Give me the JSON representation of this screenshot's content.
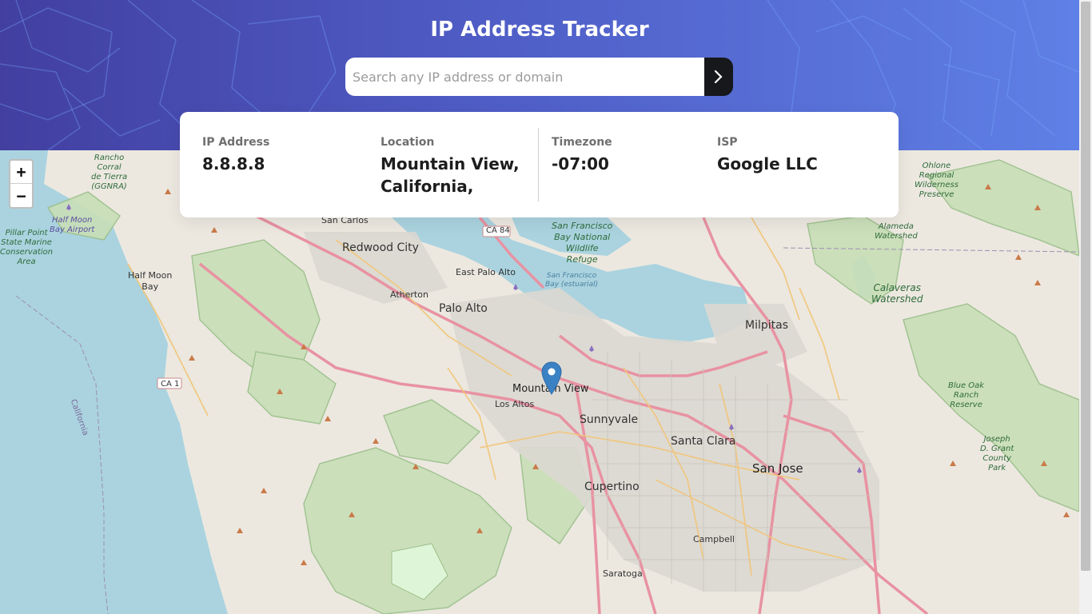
{
  "header": {
    "title": "IP Address Tracker"
  },
  "search": {
    "placeholder": "Search any IP address or domain",
    "value": "",
    "submit_icon": "chevron-right-icon"
  },
  "info": {
    "ip_label": "IP Address",
    "ip_value": "8.8.8.8",
    "location_label": "Location",
    "location_line1": "Mountain View,",
    "location_line2": "California,",
    "timezone_label": "Timezone",
    "timezone_value": "-07:00",
    "isp_label": "ISP",
    "isp_value": "Google LLC"
  },
  "map": {
    "zoom_in": "+",
    "zoom_out": "−",
    "marker_icon": "map-pin-icon",
    "labels": {
      "rancho": "Rancho\nCorral\nde Tierra\n(GGNRA)",
      "half_moon_bay_airport": "Half Moon\nBay Airport",
      "pillar_point": "Pillar Point\nState Marine\nConservation\nArea",
      "half_moon_bay": "Half Moon\nBay",
      "san_carlos": "San Carlos",
      "redwood_city": "Redwood City",
      "east_palo_alto": "East Palo Alto",
      "atherton": "Atherton",
      "palo_alto": "Palo Alto",
      "sf_bay_refuge": "San Francisco\nBay National\nWildlife\nRefuge",
      "sf_bay_estuarial": "San Francisco\nBay (estuarial)",
      "mountain_view": "Mountain View",
      "los_altos": "Los Altos",
      "sunnyvale": "Sunnyvale",
      "santa_clara": "Santa Clara",
      "san_jose": "San Jose",
      "cupertino": "Cupertino",
      "campbell": "Campbell",
      "saratoga": "Saratoga",
      "milpitas": "Milpitas",
      "ohlone": "Ohlone\nRegional\nWilderness\nPreserve",
      "alameda_watershed": "Alameda\nWatershed",
      "calaveras_watershed": "Calaveras\nWatershed",
      "blue_oak": "Blue Oak\nRanch\nReserve",
      "joseph_grant": "Joseph\nD. Grant\nCounty\nPark",
      "california": "California",
      "ca84": "CA 84",
      "ca1": "CA 1"
    }
  },
  "colors": {
    "header_start": "#423fa0",
    "header_end": "#5f80e6",
    "button_dark": "#17181c",
    "marker_blue": "#3b82c4"
  }
}
